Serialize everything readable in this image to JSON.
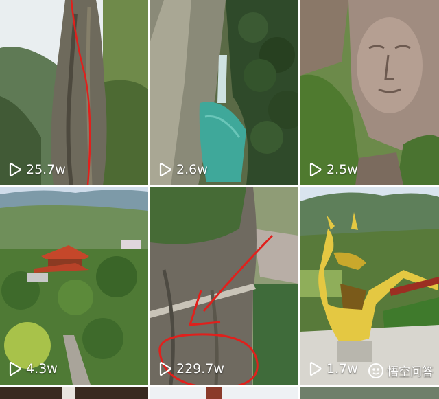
{
  "tiles": [
    {
      "views": "25.7w"
    },
    {
      "views": "2.6w"
    },
    {
      "views": "2.5w"
    },
    {
      "views": "4.3w"
    },
    {
      "views": "229.7w"
    },
    {
      "views": "1.7w"
    }
  ],
  "watermark": {
    "text": "悟空问答"
  },
  "icons": {
    "play": "play-icon",
    "logo": "wukong-logo-icon"
  },
  "colors": {
    "annotation": "#e0201c",
    "text": "#ffffff"
  }
}
